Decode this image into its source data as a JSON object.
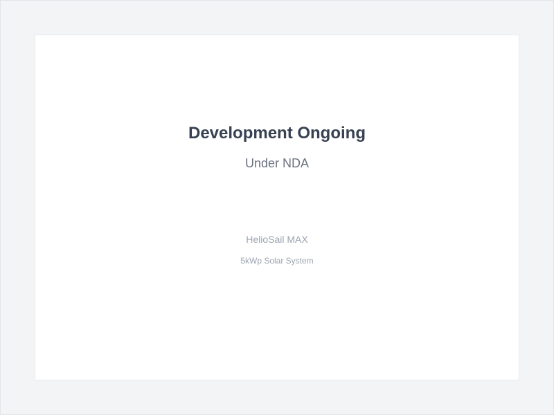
{
  "status": {
    "headline": "Development Ongoing",
    "subheadline": "Under NDA"
  },
  "product": {
    "name": "HelioSail MAX",
    "spec": "5kWp Solar System"
  },
  "colors": {
    "page_background": "#f3f4f6",
    "card_background": "#ffffff",
    "headline": "#374151",
    "subheadline": "#6b7280",
    "product_text": "#9ca3af"
  }
}
